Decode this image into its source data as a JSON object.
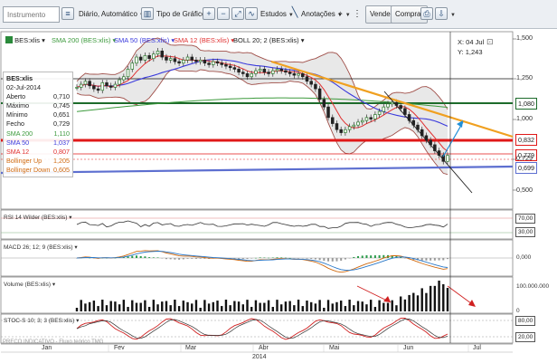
{
  "toolbar": {
    "instrument_placeholder": "Instrumento",
    "period": "Diário, Automático",
    "chart_type": "Tipo de Gráfico",
    "studies": "Estudos",
    "annotations": "Anotações",
    "sell": "Vender",
    "buy": "Comprar"
  },
  "legend": {
    "ticker": "BES:xlis",
    "sma200": "SMA 200 (BES:xlis)",
    "sma50": "SMA 50 (BES:xlis)",
    "sma12": "SMA 12 (BES:xlis)",
    "boll": "BOLL 20; 2 (BES:xlis)"
  },
  "colors": {
    "sma200": "#3c9a3c",
    "sma50": "#3a3adc",
    "sma12": "#e03030",
    "bollinger": "#a0504a",
    "bollinger_fill": "#e6e6e6",
    "candle_up": "#2a7a2a",
    "candle_down": "#222222",
    "hline_red": "#e01818",
    "hline_green": "#1d6b2b",
    "hline_blue": "#5d6fd0",
    "trend_orange": "#f0a020"
  },
  "readout": {
    "x": "X: 04 Jul",
    "y": "Y: 1,243"
  },
  "info": {
    "title": "BES:xlis",
    "date": "02-Jul-2014",
    "rows": [
      {
        "label": "Aberto",
        "value": "0,710",
        "color": "#222"
      },
      {
        "label": "Máximo",
        "value": "0,745",
        "color": "#222"
      },
      {
        "label": "Mínimo",
        "value": "0,651",
        "color": "#222"
      },
      {
        "label": "Fecho",
        "value": "0,729",
        "color": "#222"
      },
      {
        "label": "SMA 200",
        "value": "1,110",
        "color": "#3c9a3c"
      },
      {
        "label": "SMA 50",
        "value": "1,037",
        "color": "#3a3adc"
      },
      {
        "label": "SMA 12",
        "value": "0,807",
        "color": "#e03030"
      },
      {
        "label": "Bollinger Up",
        "value": "1,205",
        "color": "#d06a10"
      },
      {
        "label": "Bollinger Down",
        "value": "0,605",
        "color": "#d06a10"
      }
    ]
  },
  "price_axis": {
    "ticks": [
      "1,500",
      "1,250",
      "1,000",
      "0,750",
      "0,500"
    ],
    "tags": [
      {
        "text": "1,080",
        "color": "#1d6b2b"
      },
      {
        "text": "0,832",
        "color": "#e01818"
      },
      {
        "text": "0,779",
        "color": "#e01818"
      },
      {
        "text": "0,729",
        "color": "#222"
      },
      {
        "text": "0,699",
        "color": "#5d6fd0"
      }
    ]
  },
  "panels": {
    "rsi": {
      "label": "RSI 14 Wilder (BES:xlis)",
      "ticks": [
        "70,00",
        "30,00"
      ]
    },
    "macd": {
      "label": "MACD 26; 12; 9 (BES:xlis)",
      "ticks": [
        "0,000"
      ]
    },
    "volume": {
      "label": "Volume (BES:xlis)",
      "ticks": [
        "100.000.000",
        "0"
      ]
    },
    "stoch": {
      "label": "STOC-S 10; 3; 3 (BES:xlis)",
      "ticks": [
        "80,00",
        "20,00"
      ]
    }
  },
  "footer": "PREÇO INDICATIVO - Fluxo teórico TMG",
  "x_axis": {
    "months": [
      "Jan",
      "Fev",
      "Mar",
      "Abr",
      "Mai",
      "Jun",
      "Jul"
    ],
    "year": "2014"
  },
  "chart_data": {
    "type": "line",
    "title": "BES:xlis",
    "ylim": [
      0.45,
      1.55
    ],
    "close": [
      1.18,
      1.2,
      1.22,
      1.19,
      1.17,
      1.16,
      1.21,
      1.19,
      1.18,
      1.2,
      1.23,
      1.25,
      1.3,
      1.34,
      1.38,
      1.36,
      1.39,
      1.37,
      1.4,
      1.42,
      1.38,
      1.36,
      1.37,
      1.35,
      1.34,
      1.36,
      1.38,
      1.36,
      1.35,
      1.36,
      1.34,
      1.33,
      1.35,
      1.34,
      1.33,
      1.32,
      1.31,
      1.3,
      1.28,
      1.27,
      1.25,
      1.27,
      1.29,
      1.3,
      1.28,
      1.27,
      1.29,
      1.3,
      1.29,
      1.28,
      1.27,
      1.26,
      1.27,
      1.25,
      1.22,
      1.2,
      1.17,
      1.1,
      1.05,
      0.98,
      0.94,
      0.9,
      0.88,
      0.9,
      0.92,
      0.93,
      0.95,
      0.96,
      0.98,
      0.97,
      1.0,
      1.02,
      1.05,
      1.07,
      1.08,
      1.06,
      1.04,
      1.0,
      0.96,
      0.93,
      0.9,
      0.86,
      0.83,
      0.8,
      0.76,
      0.73,
      0.69,
      0.73
    ],
    "sma200_range": [
      1.02,
      1.11
    ],
    "sma50_range": [
      0.98,
      1.34
    ],
    "hlines": [
      1.08,
      0.832,
      0.779
    ],
    "support_line": [
      0.7,
      0.67
    ],
    "rsi": {
      "ylim": [
        0,
        100
      ],
      "levels": [
        70,
        30
      ]
    },
    "volume_note": "spike in late Jun 2014",
    "months": [
      "Jan",
      "Fev",
      "Mar",
      "Abr",
      "Mai",
      "Jun",
      "Jul"
    ],
    "year": "2014"
  }
}
